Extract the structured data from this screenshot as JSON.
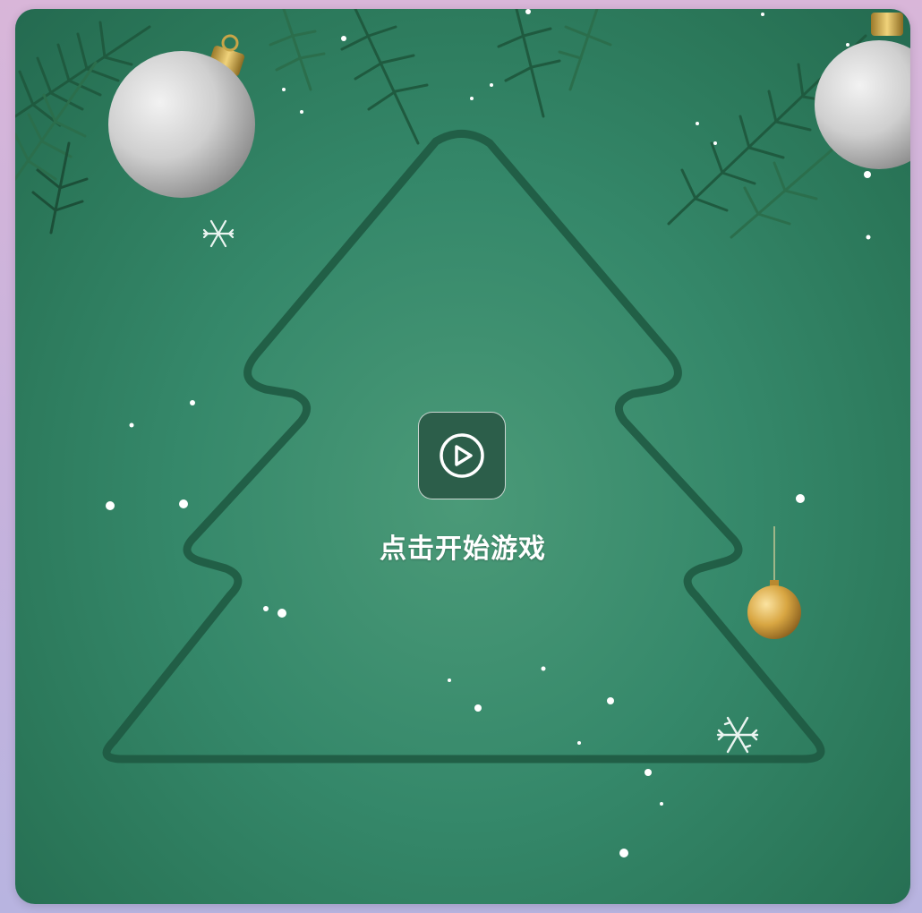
{
  "game": {
    "start_label": "点击开始游戏"
  },
  "icons": {
    "play": "play-circle-icon",
    "snowflake": "snowflake-icon",
    "ornament": "ornament-icon",
    "branch": "pine-branch-icon"
  },
  "colors": {
    "background_green": "#35886a",
    "tree_outline": "#1f5a43",
    "button_bg": "#2c5e4a",
    "silver": "#d2d2d2",
    "gold": "#d8a642"
  }
}
